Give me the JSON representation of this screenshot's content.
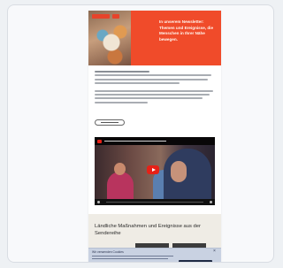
{
  "hero": {
    "headline": "In unserem Newsletter: Themen und Ereignisse, die Menschen in Ihrer Nähe bewegen."
  },
  "section": {
    "title": "Ländliche Maßnahmen und Ereignisse aus der Sendereihe"
  },
  "cookie_banner": {
    "title": "Wir verwenden Cookies"
  },
  "colors": {
    "hero_accent": "#f04b2a",
    "youtube_red": "#e62117",
    "cookie_bg": "#c9d2e2",
    "cookie_button": "#1f2a44"
  }
}
